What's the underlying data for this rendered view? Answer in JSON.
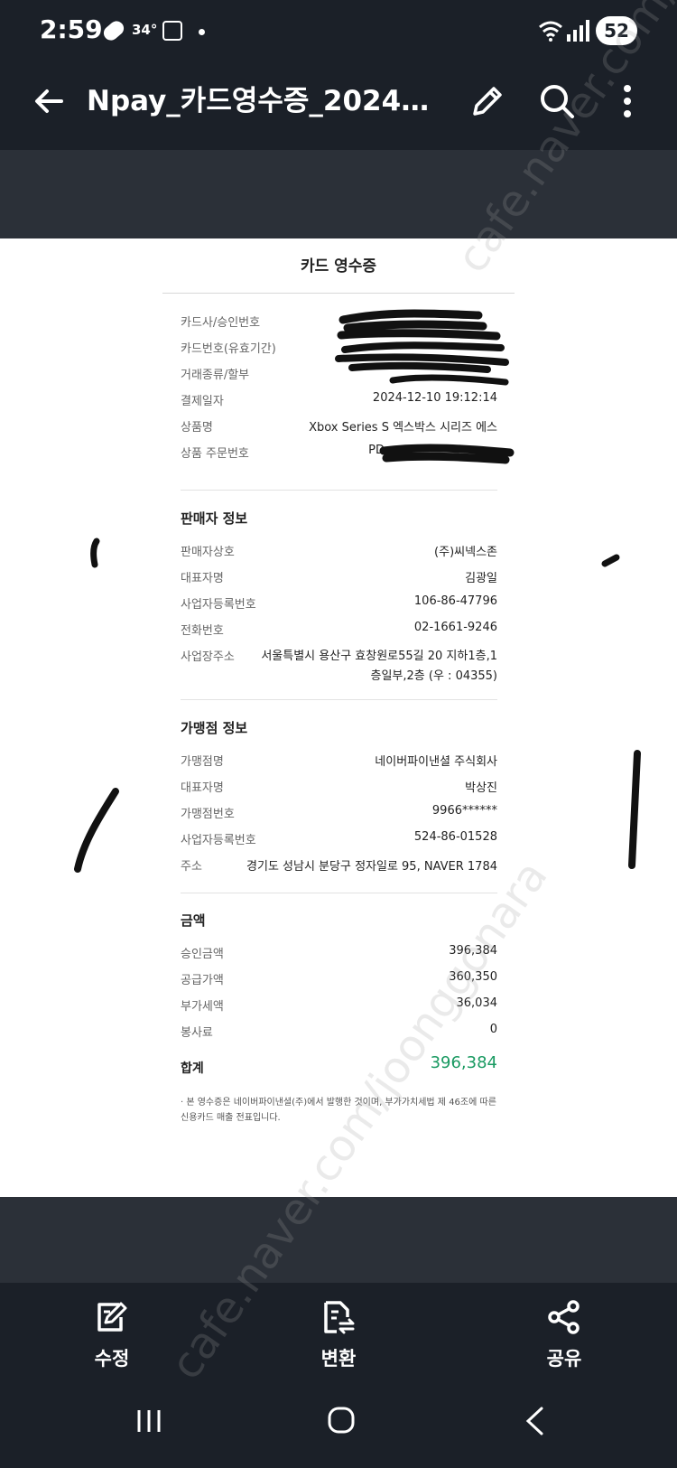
{
  "status_bar": {
    "time": "2:59",
    "temperature": "34°",
    "battery": "52"
  },
  "app_bar": {
    "title": "Npay_카드영수증_202412..."
  },
  "receipt": {
    "title": "카드 영수증",
    "transaction": [
      {
        "label": "카드사/승인번호",
        "value": ""
      },
      {
        "label": "카드번호(유효기간)",
        "value": ""
      },
      {
        "label": "거래종류/할부",
        "value": ""
      },
      {
        "label": "결제일자",
        "value": "2024-12-10 19:12:14"
      },
      {
        "label": "상품명",
        "value": "Xbox Series S 엑스박스 시리즈 에스"
      },
      {
        "label": "상품 주문번호",
        "value": "PD"
      }
    ],
    "seller": {
      "title": "판매자 정보",
      "rows": [
        {
          "label": "판매자상호",
          "value": "(주)씨넥스존"
        },
        {
          "label": "대표자명",
          "value": "김광일"
        },
        {
          "label": "사업자등록번호",
          "value": "106-86-47796"
        },
        {
          "label": "전화번호",
          "value": "02-1661-9246"
        },
        {
          "label": "사업장주소",
          "value": "서울특별시 용산구 효창원로55길 20 지하1층,1층일부,2층 (우 : 04355)"
        }
      ]
    },
    "merchant": {
      "title": "가맹점 정보",
      "rows": [
        {
          "label": "가맹점명",
          "value": "네이버파이낸셜 주식회사"
        },
        {
          "label": "대표자명",
          "value": "박상진"
        },
        {
          "label": "가맹점번호",
          "value": "9966******"
        },
        {
          "label": "사업자등록번호",
          "value": "524-86-01528"
        },
        {
          "label": "주소",
          "value": "경기도 성남시 분당구 정자일로 95, NAVER 1784"
        }
      ]
    },
    "amount": {
      "title": "금액",
      "rows": [
        {
          "label": "승인금액",
          "value": "396,384"
        },
        {
          "label": "공급가액",
          "value": "360,350"
        },
        {
          "label": "부가세액",
          "value": "36,034"
        },
        {
          "label": "봉사료",
          "value": "0"
        }
      ],
      "total_label": "합계",
      "total_value": "396,384",
      "total_color": "#1a9a62"
    },
    "footnote": "· 본 영수증은 네이버파이낸셜(주)에서 발행한 것이며, 부가가치세법 제 46조에 따른 신용카드 매출 전표입니다."
  },
  "bottom_actions": [
    {
      "label": "수정",
      "icon": "edit-doc-icon"
    },
    {
      "label": "변환",
      "icon": "convert-doc-icon"
    },
    {
      "label": "공유",
      "icon": "share-icon"
    }
  ],
  "watermark": "cafe.naver.com/joonggonara",
  "colors": {
    "bar_bg": "#1b2028",
    "band_bg": "#2b3038",
    "sheet_bg": "#ffffff"
  }
}
